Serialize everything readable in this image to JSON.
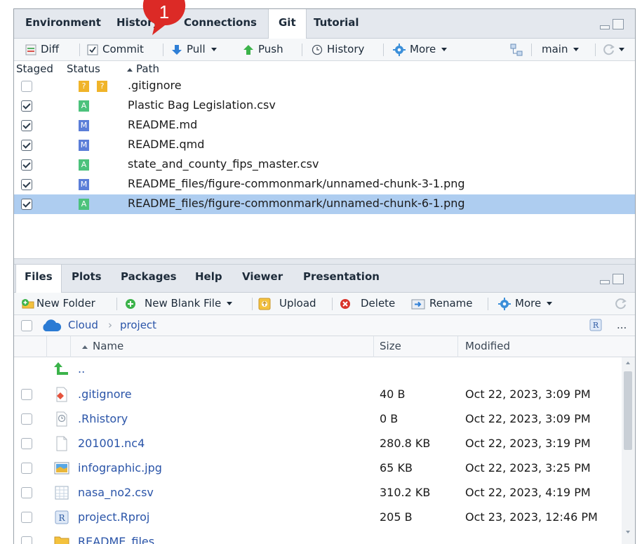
{
  "annotation": {
    "number": "1",
    "color": "#dc2a26"
  },
  "git_pane": {
    "tabs": [
      "Environment",
      "History",
      "Connections",
      "Git",
      "Tutorial"
    ],
    "active_tab": "Git",
    "toolbar": {
      "diff": "Diff",
      "commit": "Commit",
      "pull": "Pull",
      "push": "Push",
      "history": "History",
      "more": "More",
      "branch": "main"
    },
    "columns": {
      "staged": "Staged",
      "status": "Status",
      "path": "Path"
    },
    "rows": [
      {
        "staged": false,
        "status": [
          "?",
          "?"
        ],
        "path": ".gitignore",
        "selected": false
      },
      {
        "staged": true,
        "status": [
          "A"
        ],
        "path": "Plastic Bag Legislation.csv",
        "selected": false
      },
      {
        "staged": true,
        "status": [
          "M"
        ],
        "path": "README.md",
        "selected": false
      },
      {
        "staged": true,
        "status": [
          "M"
        ],
        "path": "README.qmd",
        "selected": false
      },
      {
        "staged": true,
        "status": [
          "A"
        ],
        "path": "state_and_county_fips_master.csv",
        "selected": false
      },
      {
        "staged": true,
        "status": [
          "M"
        ],
        "path": "README_files/figure-commonmark/unnamed-chunk-3-1.png",
        "selected": false
      },
      {
        "staged": true,
        "status": [
          "A"
        ],
        "path": "README_files/figure-commonmark/unnamed-chunk-6-1.png",
        "selected": true
      }
    ]
  },
  "files_pane": {
    "tabs": [
      "Files",
      "Plots",
      "Packages",
      "Help",
      "Viewer",
      "Presentation"
    ],
    "active_tab": "Files",
    "toolbar": {
      "new_folder": "New Folder",
      "new_blank_file": "New Blank File",
      "upload": "Upload",
      "delete": "Delete",
      "rename": "Rename",
      "more": "More"
    },
    "breadcrumb": [
      "Cloud",
      "project"
    ],
    "ellipsis": "...",
    "columns": {
      "name": "Name",
      "size": "Size",
      "modified": "Modified"
    },
    "up_label": "..",
    "rows": [
      {
        "icon": "git-file-icon",
        "name": ".gitignore",
        "size": "40 B",
        "modified": "Oct 22, 2023, 3:09 PM"
      },
      {
        "icon": "history-file-icon",
        "name": ".Rhistory",
        "size": "0 B",
        "modified": "Oct 22, 2023, 3:09 PM"
      },
      {
        "icon": "blank-file-icon",
        "name": "201001.nc4",
        "size": "280.8 KB",
        "modified": "Oct 22, 2023, 3:19 PM"
      },
      {
        "icon": "image-file-icon",
        "name": "infographic.jpg",
        "size": "65 KB",
        "modified": "Oct 22, 2023, 3:25 PM"
      },
      {
        "icon": "csv-file-icon",
        "name": "nasa_no2.csv",
        "size": "310.2 KB",
        "modified": "Oct 22, 2023, 4:19 PM"
      },
      {
        "icon": "rproj-file-icon",
        "name": "project.Rproj",
        "size": "205 B",
        "modified": "Oct 23, 2023, 12:46 PM"
      },
      {
        "icon": "folder-icon",
        "name": "README_files",
        "size": "",
        "modified": ""
      }
    ]
  }
}
